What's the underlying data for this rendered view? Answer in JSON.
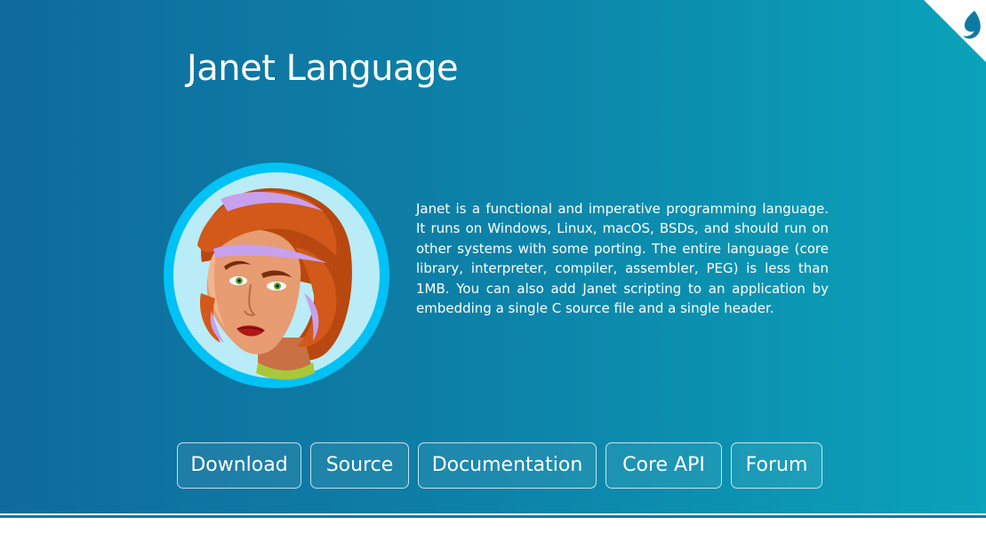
{
  "title": "Janet Language",
  "intro": "Janet is a functional and imperative programming language. It runs on Windows, Linux, macOS, BSDs, and should run on other systems with some porting. The entire language (core library, interpreter, compiler, assembler, PEG) is less than 1MB. You can also add Janet scripting to an application by embedding a single C source file and a single header.",
  "nav_buttons": [
    {
      "label": "Download"
    },
    {
      "label": "Source"
    },
    {
      "label": "Documentation"
    },
    {
      "label": "Core API"
    },
    {
      "label": "Forum"
    }
  ],
  "colors": {
    "background_start": "#0f6b9c",
    "background_end": "#0aa3ba",
    "text": "#ffffff",
    "avatar_ring": "#00c2f5"
  },
  "icons": {
    "corner": "janet-drop-logo-icon",
    "avatar": "janet-portrait-avatar"
  }
}
